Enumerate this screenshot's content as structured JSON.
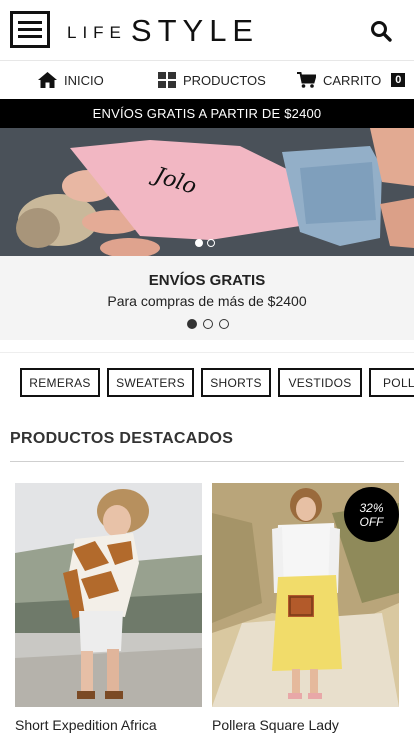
{
  "header": {
    "logo_small": "LIFE",
    "logo_big": "STYLE",
    "menu_icon": "hamburger-icon",
    "search_icon": "search-icon"
  },
  "nav": {
    "inicio": {
      "label": "INICIO",
      "icon": "home-icon"
    },
    "productos": {
      "label": "PRODUCTOS",
      "icon": "grid-icon"
    },
    "carrito": {
      "label": "CARRITO",
      "icon": "cart-icon",
      "count": "0"
    }
  },
  "promo_bar": {
    "text": "ENVÍOS GRATIS A PARTIR DE $2400"
  },
  "hero": {
    "active_dot": 0,
    "dot_count": 2
  },
  "slide": {
    "title": "ENVÍOS GRATIS",
    "subtitle": "Para compras de más de $2400",
    "active_dot": 0,
    "dot_count": 3
  },
  "categories": [
    "REMERAS",
    "SWEATERS",
    "SHORTS",
    "VESTIDOS",
    "POLLERAS"
  ],
  "featured": {
    "title": "PRODUCTOS DESTACADOS",
    "products": [
      {
        "name": "Short Expedition Africa"
      },
      {
        "name": "Pollera Square Lady",
        "badge_pct": "32%",
        "badge_text": "OFF"
      }
    ]
  },
  "colors": {
    "accent": "#000000",
    "hero_shirt": "#f4b8c4",
    "skirt": "#f1dc6a"
  }
}
